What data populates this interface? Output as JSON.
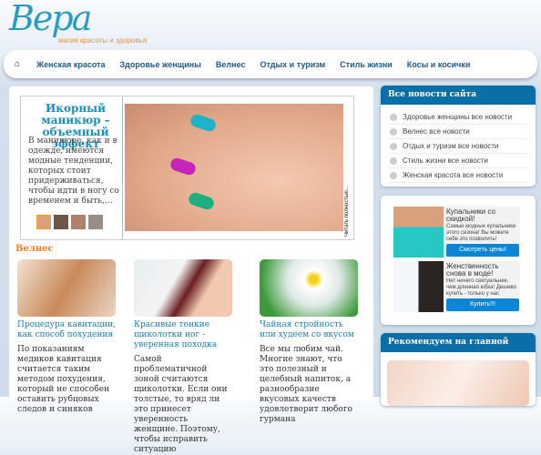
{
  "logo": {
    "text": "Вера",
    "tagline": "магия красоты и здоровья"
  },
  "nav": {
    "items": [
      "Женская красота",
      "Здоровье женщины",
      "Велнес",
      "Отдых и туризм",
      "Стиль жизни",
      "Косы и косички"
    ]
  },
  "slider": {
    "title": "Икорный маникюр – объемный эффект",
    "body": "В маникюре, как и в одежде, имеются модные тенденции, которых стоит придерживаться, чтобы идти в ногу со временем и быть,…",
    "read_more": "Читать полностью..."
  },
  "section": {
    "title": "Велнес",
    "cards": [
      {
        "title": "Процедура кавитации, как способ похудения",
        "desc": "По показаниям медиков кавитация считается таким методом похудения, который не способен оставить рубцовых следов и синяков"
      },
      {
        "title": "Красивые тонкие щиколотки ног - уверенная походка",
        "desc": "Самой проблематичной зоной считаются щиколотки. Если они толстые, то вряд ли это принесет уверенность женщине. Поэтому, чтобы исправить ситуацию"
      },
      {
        "title": "Чайная стройность или худеем со вкусом",
        "desc": "Все мы любим чай. Многие знают, что это полезный и целебный напиток, а разнообразие вкусовых качеств удовлетворит любого гурмана"
      }
    ]
  },
  "sidebar": {
    "news_title": "Все новости сайта",
    "news": [
      "Здоровье женщины все новости",
      "Велнес все новости",
      "Отдых и туризм все новости",
      "Стиль жизни все новости",
      "Женская красота все новости"
    ],
    "ads": [
      {
        "title": "Купальники со скидкой!",
        "body": "Самые модные купальники этого сезона! Вы можете себе это позволить!",
        "button": "Смотреть цены!"
      },
      {
        "title": "Женственность снова в моде!",
        "body": "Нет ничего сексуальнее, чем длинная юбка! Дешево купить - только у нас",
        "button": "Купить!!!"
      }
    ],
    "recommend_title": "Рекомендуем на главной"
  }
}
